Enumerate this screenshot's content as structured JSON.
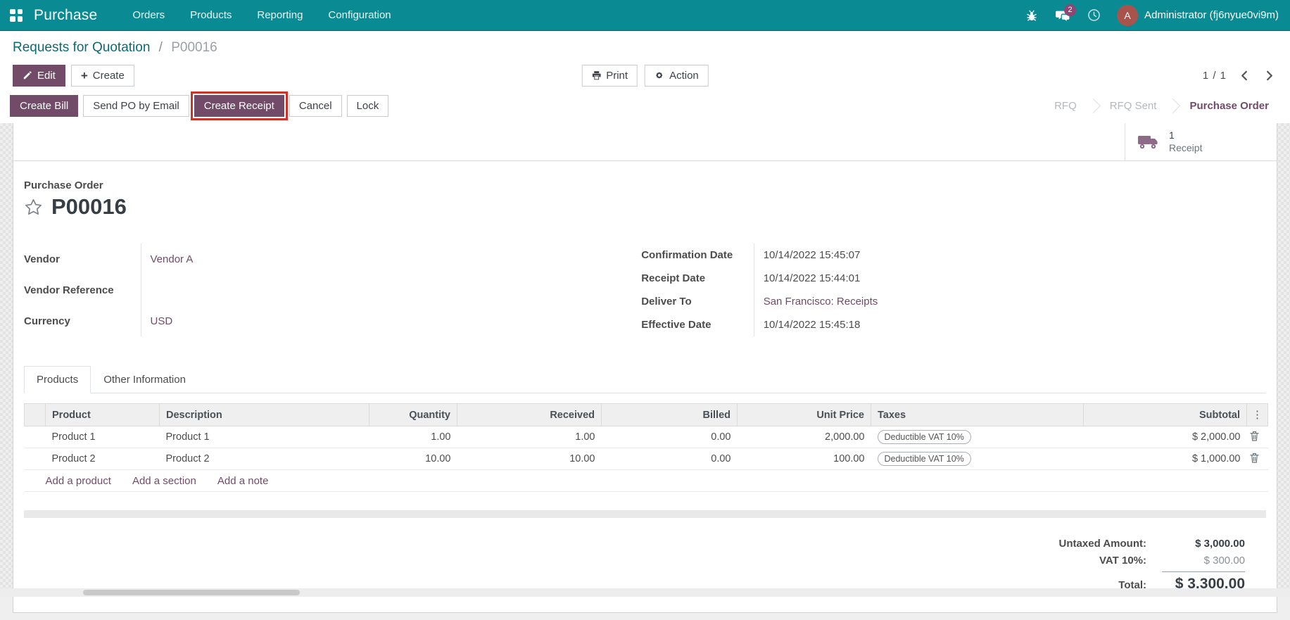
{
  "colors": {
    "navbar_teal": "#0a8b94",
    "primary_purple": "#714b67",
    "highlight_red": "#cb342b",
    "badge_purple": "#8f4673",
    "avatar_brown": "#a8544c",
    "link_purple": "#714b67"
  },
  "navbar": {
    "app_name": "Purchase",
    "menus": [
      "Orders",
      "Products",
      "Reporting",
      "Configuration"
    ],
    "message_badge": "2",
    "avatar_letter": "A",
    "user_name": "Administrator (fj6nyue0vi9m)"
  },
  "breadcrumb": {
    "parent": "Requests for Quotation",
    "separator": "/",
    "current": "P00016"
  },
  "toolbar": {
    "edit": "Edit",
    "create": "Create",
    "print": "Print",
    "action": "Action",
    "pager": "1 / 1"
  },
  "statusbar": {
    "buttons": [
      {
        "label": "Create Bill",
        "style": "primary",
        "highlighted": false
      },
      {
        "label": "Send PO by Email",
        "style": "secondary",
        "highlighted": false
      },
      {
        "label": "Create Receipt",
        "style": "primary",
        "highlighted": true
      },
      {
        "label": "Cancel",
        "style": "secondary",
        "highlighted": false
      },
      {
        "label": "Lock",
        "style": "secondary",
        "highlighted": false
      }
    ],
    "states": [
      {
        "label": "RFQ",
        "active": false
      },
      {
        "label": "RFQ Sent",
        "active": false
      },
      {
        "label": "Purchase Order",
        "active": true
      }
    ]
  },
  "sheet": {
    "smart_button": {
      "count": "1",
      "label": "Receipt"
    },
    "doc_type_label": "Purchase Order",
    "doc_name": "P00016",
    "fields_left": [
      {
        "label": "Vendor",
        "value": "Vendor A"
      },
      {
        "label": "Vendor Reference",
        "value": ""
      },
      {
        "label": "Currency",
        "value": "USD"
      }
    ],
    "fields_right": [
      {
        "label": "Confirmation Date",
        "value": "10/14/2022 15:45:07"
      },
      {
        "label": "Receipt Date",
        "value": "10/14/2022 15:44:01"
      },
      {
        "label": "Deliver To",
        "value": "San Francisco: Receipts"
      },
      {
        "label": "Effective Date",
        "value": "10/14/2022 15:45:18"
      }
    ],
    "tabs": [
      {
        "label": "Products",
        "active": true
      },
      {
        "label": "Other Information",
        "active": false
      }
    ],
    "table": {
      "headers": [
        "Product",
        "Description",
        "Quantity",
        "Received",
        "Billed",
        "Unit Price",
        "Taxes",
        "Subtotal"
      ],
      "options_icon": "⋮",
      "rows": [
        {
          "product": "Product 1",
          "description": "Product 1",
          "quantity": "1.00",
          "received": "1.00",
          "billed": "0.00",
          "unit_price": "2,000.00",
          "taxes": "Deductible VAT 10%",
          "subtotal": "$ 2,000.00"
        },
        {
          "product": "Product 2",
          "description": "Product 2",
          "quantity": "10.00",
          "received": "10.00",
          "billed": "0.00",
          "unit_price": "100.00",
          "taxes": "Deductible VAT 10%",
          "subtotal": "$ 1,000.00"
        }
      ],
      "footer_links": [
        "Add a product",
        "Add a section",
        "Add a note"
      ]
    },
    "totals": {
      "untaxed_label": "Untaxed Amount:",
      "untaxed_value": "$ 3,000.00",
      "tax_label": "VAT 10%:",
      "tax_value": "$ 300.00",
      "total_label": "Total:",
      "total_value": "$ 3,300.00"
    }
  }
}
